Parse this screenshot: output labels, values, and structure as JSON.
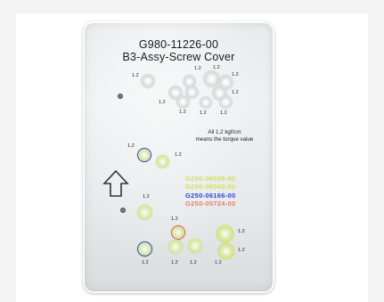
{
  "plate": {
    "part_number": "G980-11226-00",
    "part_name": "B3-Assy-Screw Cover",
    "torque_note": {
      "line1": "All 1.2 kgf/cm",
      "line2": "means the torque value"
    },
    "legend": [
      {
        "code": "G256-06539-00",
        "color": "#d7dc63"
      },
      {
        "code": "G256-06540-00",
        "color": "#d9df57"
      },
      {
        "code": "G250-06166-00",
        "color": "#2d43e0"
      },
      {
        "code": "G250-05724-00",
        "color": "#ea7f72"
      }
    ],
    "torque_label": "1.2",
    "arrow_icon": "up-arrow-outline-icon"
  }
}
